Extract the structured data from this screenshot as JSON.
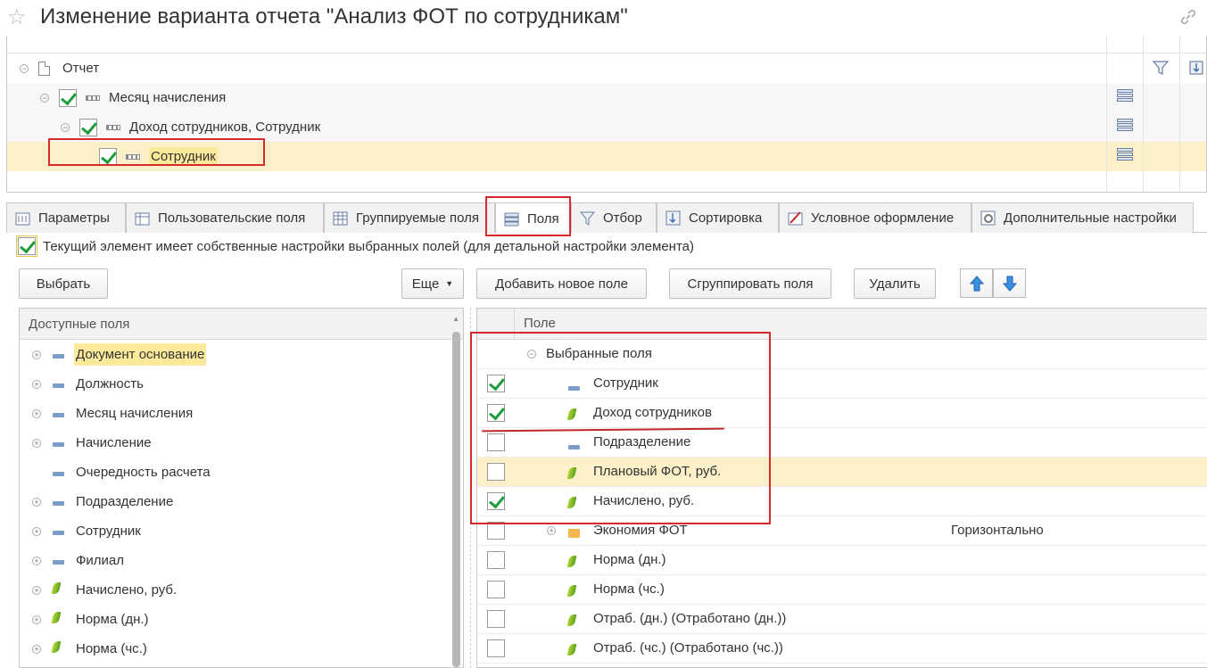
{
  "window": {
    "title": "Изменение варианта отчета \"Анализ ФОТ по сотрудникам\""
  },
  "structure": {
    "items": [
      {
        "label": "Отчет"
      },
      {
        "label": "Месяц начисления"
      },
      {
        "label": "Доход сотрудников, Сотрудник"
      },
      {
        "label": "Сотрудник"
      }
    ]
  },
  "tabs": [
    {
      "label": "Параметры"
    },
    {
      "label": "Пользовательские поля"
    },
    {
      "label": "Группируемые поля"
    },
    {
      "label": "Поля"
    },
    {
      "label": "Отбор"
    },
    {
      "label": "Сортировка"
    },
    {
      "label": "Условное оформление"
    },
    {
      "label": "Дополнительные настройки"
    }
  ],
  "own_settings_label": "Текущий элемент имеет собственные настройки выбранных полей (для детальной настройки элемента)",
  "left_toolbar": {
    "select_label": "Выбрать",
    "more_label": "Еще"
  },
  "right_toolbar": {
    "add_label": "Добавить новое поле",
    "group_label": "Сгруппировать поля",
    "delete_label": "Удалить"
  },
  "available_fields": {
    "header": "Доступные поля",
    "items": [
      {
        "label": "Документ основание",
        "icon": "attribute-icon",
        "expandable": true
      },
      {
        "label": "Должность",
        "icon": "attribute-icon",
        "expandable": true
      },
      {
        "label": "Месяц начисления",
        "icon": "attribute-icon",
        "expandable": true
      },
      {
        "label": "Начисление",
        "icon": "attribute-icon",
        "expandable": true
      },
      {
        "label": "Очередность расчета",
        "icon": "attribute-icon",
        "expandable": false
      },
      {
        "label": "Подразделение",
        "icon": "attribute-icon",
        "expandable": true
      },
      {
        "label": "Сотрудник",
        "icon": "attribute-icon",
        "expandable": true
      },
      {
        "label": "Филиал",
        "icon": "attribute-icon",
        "expandable": true
      },
      {
        "label": "Начислено, руб.",
        "icon": "resource-icon",
        "expandable": true
      },
      {
        "label": "Норма (дн.)",
        "icon": "resource-icon",
        "expandable": true
      },
      {
        "label": "Норма (чс.)",
        "icon": "resource-icon",
        "expandable": true
      }
    ]
  },
  "selected_fields": {
    "header": "Поле",
    "group_label": "Выбранные поля",
    "items": [
      {
        "label": "Сотрудник",
        "checked": true,
        "icon": "attribute-icon"
      },
      {
        "label": "Доход сотрудников",
        "checked": true,
        "icon": "resource-icon"
      },
      {
        "label": "Подразделение",
        "checked": false,
        "icon": "attribute-icon"
      },
      {
        "label": "Плановый ФОТ, руб.",
        "checked": false,
        "icon": "resource-icon"
      },
      {
        "label": "Начислено, руб.",
        "checked": true,
        "icon": "resource-icon"
      },
      {
        "label": "Экономия ФОТ",
        "checked": false,
        "icon": "folder-icon",
        "extra": "Горизонтально"
      },
      {
        "label": "Норма (дн.)",
        "checked": false,
        "icon": "resource-icon"
      },
      {
        "label": "Норма (чс.)",
        "checked": false,
        "icon": "resource-icon"
      },
      {
        "label": "Отраб. (дн.) (Отработано (дн.))",
        "checked": false,
        "icon": "resource-icon"
      },
      {
        "label": "Отраб. (чс.) (Отработано (чс.))",
        "checked": false,
        "icon": "resource-icon"
      }
    ]
  },
  "colors": {
    "highlight": "#fde99a",
    "selected_row": "#fbf0c7",
    "annotation_red": "#d42a2a",
    "check_green": "#1e9e3a"
  }
}
